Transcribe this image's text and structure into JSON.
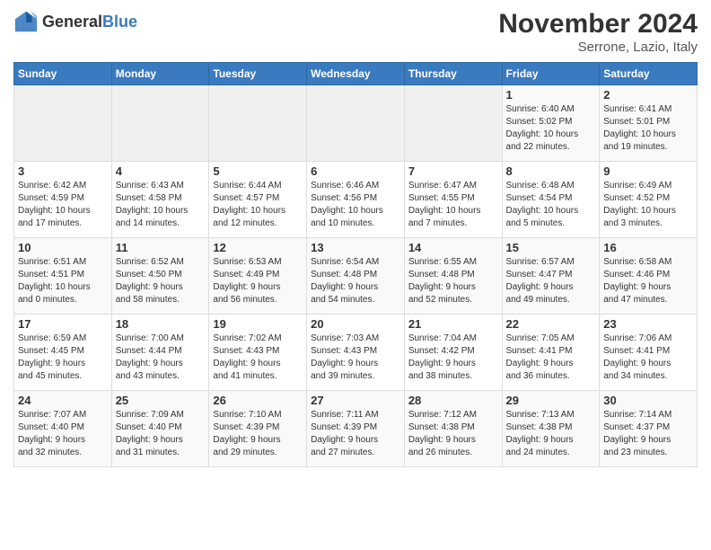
{
  "header": {
    "logo_general": "General",
    "logo_blue": "Blue",
    "month_title": "November 2024",
    "location": "Serrone, Lazio, Italy"
  },
  "weekdays": [
    "Sunday",
    "Monday",
    "Tuesday",
    "Wednesday",
    "Thursday",
    "Friday",
    "Saturday"
  ],
  "weeks": [
    [
      {
        "day": "",
        "info": ""
      },
      {
        "day": "",
        "info": ""
      },
      {
        "day": "",
        "info": ""
      },
      {
        "day": "",
        "info": ""
      },
      {
        "day": "",
        "info": ""
      },
      {
        "day": "1",
        "info": "Sunrise: 6:40 AM\nSunset: 5:02 PM\nDaylight: 10 hours\nand 22 minutes."
      },
      {
        "day": "2",
        "info": "Sunrise: 6:41 AM\nSunset: 5:01 PM\nDaylight: 10 hours\nand 19 minutes."
      }
    ],
    [
      {
        "day": "3",
        "info": "Sunrise: 6:42 AM\nSunset: 4:59 PM\nDaylight: 10 hours\nand 17 minutes."
      },
      {
        "day": "4",
        "info": "Sunrise: 6:43 AM\nSunset: 4:58 PM\nDaylight: 10 hours\nand 14 minutes."
      },
      {
        "day": "5",
        "info": "Sunrise: 6:44 AM\nSunset: 4:57 PM\nDaylight: 10 hours\nand 12 minutes."
      },
      {
        "day": "6",
        "info": "Sunrise: 6:46 AM\nSunset: 4:56 PM\nDaylight: 10 hours\nand 10 minutes."
      },
      {
        "day": "7",
        "info": "Sunrise: 6:47 AM\nSunset: 4:55 PM\nDaylight: 10 hours\nand 7 minutes."
      },
      {
        "day": "8",
        "info": "Sunrise: 6:48 AM\nSunset: 4:54 PM\nDaylight: 10 hours\nand 5 minutes."
      },
      {
        "day": "9",
        "info": "Sunrise: 6:49 AM\nSunset: 4:52 PM\nDaylight: 10 hours\nand 3 minutes."
      }
    ],
    [
      {
        "day": "10",
        "info": "Sunrise: 6:51 AM\nSunset: 4:51 PM\nDaylight: 10 hours\nand 0 minutes."
      },
      {
        "day": "11",
        "info": "Sunrise: 6:52 AM\nSunset: 4:50 PM\nDaylight: 9 hours\nand 58 minutes."
      },
      {
        "day": "12",
        "info": "Sunrise: 6:53 AM\nSunset: 4:49 PM\nDaylight: 9 hours\nand 56 minutes."
      },
      {
        "day": "13",
        "info": "Sunrise: 6:54 AM\nSunset: 4:48 PM\nDaylight: 9 hours\nand 54 minutes."
      },
      {
        "day": "14",
        "info": "Sunrise: 6:55 AM\nSunset: 4:48 PM\nDaylight: 9 hours\nand 52 minutes."
      },
      {
        "day": "15",
        "info": "Sunrise: 6:57 AM\nSunset: 4:47 PM\nDaylight: 9 hours\nand 49 minutes."
      },
      {
        "day": "16",
        "info": "Sunrise: 6:58 AM\nSunset: 4:46 PM\nDaylight: 9 hours\nand 47 minutes."
      }
    ],
    [
      {
        "day": "17",
        "info": "Sunrise: 6:59 AM\nSunset: 4:45 PM\nDaylight: 9 hours\nand 45 minutes."
      },
      {
        "day": "18",
        "info": "Sunrise: 7:00 AM\nSunset: 4:44 PM\nDaylight: 9 hours\nand 43 minutes."
      },
      {
        "day": "19",
        "info": "Sunrise: 7:02 AM\nSunset: 4:43 PM\nDaylight: 9 hours\nand 41 minutes."
      },
      {
        "day": "20",
        "info": "Sunrise: 7:03 AM\nSunset: 4:43 PM\nDaylight: 9 hours\nand 39 minutes."
      },
      {
        "day": "21",
        "info": "Sunrise: 7:04 AM\nSunset: 4:42 PM\nDaylight: 9 hours\nand 38 minutes."
      },
      {
        "day": "22",
        "info": "Sunrise: 7:05 AM\nSunset: 4:41 PM\nDaylight: 9 hours\nand 36 minutes."
      },
      {
        "day": "23",
        "info": "Sunrise: 7:06 AM\nSunset: 4:41 PM\nDaylight: 9 hours\nand 34 minutes."
      }
    ],
    [
      {
        "day": "24",
        "info": "Sunrise: 7:07 AM\nSunset: 4:40 PM\nDaylight: 9 hours\nand 32 minutes."
      },
      {
        "day": "25",
        "info": "Sunrise: 7:09 AM\nSunset: 4:40 PM\nDaylight: 9 hours\nand 31 minutes."
      },
      {
        "day": "26",
        "info": "Sunrise: 7:10 AM\nSunset: 4:39 PM\nDaylight: 9 hours\nand 29 minutes."
      },
      {
        "day": "27",
        "info": "Sunrise: 7:11 AM\nSunset: 4:39 PM\nDaylight: 9 hours\nand 27 minutes."
      },
      {
        "day": "28",
        "info": "Sunrise: 7:12 AM\nSunset: 4:38 PM\nDaylight: 9 hours\nand 26 minutes."
      },
      {
        "day": "29",
        "info": "Sunrise: 7:13 AM\nSunset: 4:38 PM\nDaylight: 9 hours\nand 24 minutes."
      },
      {
        "day": "30",
        "info": "Sunrise: 7:14 AM\nSunset: 4:37 PM\nDaylight: 9 hours\nand 23 minutes."
      }
    ]
  ]
}
